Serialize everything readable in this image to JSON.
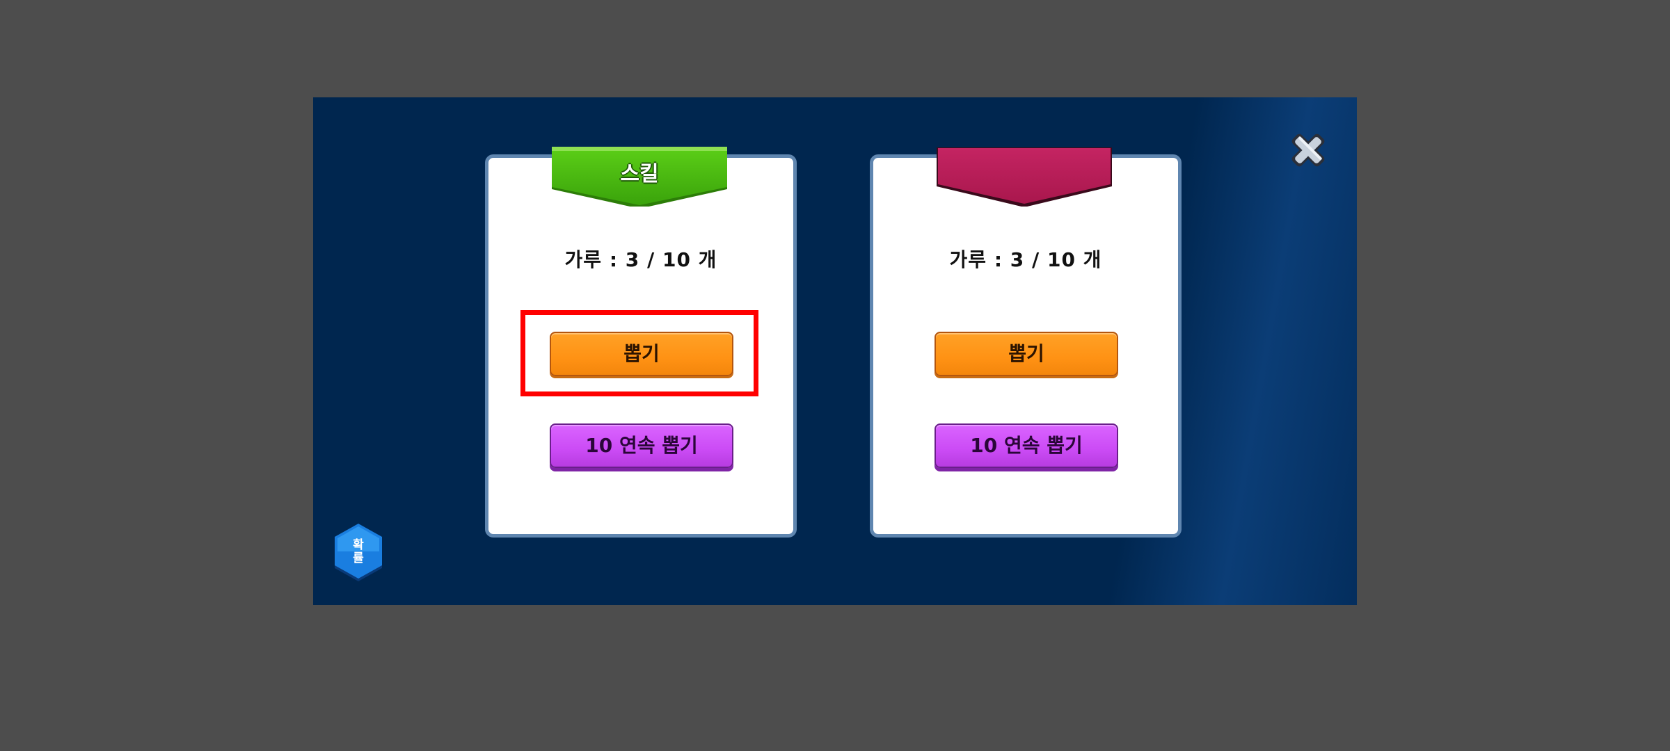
{
  "colors": {
    "overlay": "#4d4d4d",
    "panel": "#00264f",
    "card_border": "#5f86b0",
    "ribbon_green": "#4cbc12",
    "ribbon_red": "#b81e58",
    "button_orange": "#ff9214",
    "button_purple": "#cb4bf5",
    "highlight": "#ff0000"
  },
  "cards": [
    {
      "ribbon_label": "스킬",
      "ribbon_color": "green",
      "count_text": "가루 : 3 / 10 개",
      "single_draw_label": "뽑기",
      "multi_draw_label": "10 연속 뽑기"
    },
    {
      "ribbon_label": "",
      "ribbon_color": "red",
      "count_text": "가루 : 3 / 10 개",
      "single_draw_label": "뽑기",
      "multi_draw_label": "10 연속 뽑기"
    }
  ],
  "probability_button_label": "확\n률",
  "icons": {
    "close": "close-x-icon",
    "probability": "hexagon-icon"
  }
}
